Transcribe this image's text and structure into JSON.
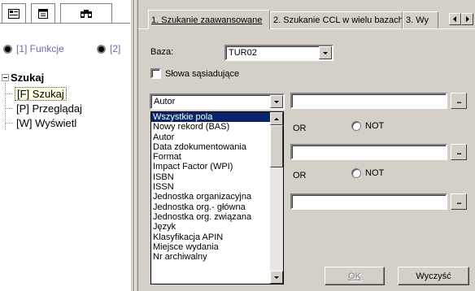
{
  "left_pane": {
    "tabs": [
      {
        "icon": "tree-view-icon"
      },
      {
        "icon": "document-icon"
      },
      {
        "icon": "binoculars-icon"
      }
    ],
    "radio_options": [
      "[1] Funkcje",
      "[2]"
    ],
    "tree": {
      "root": "Szukaj",
      "children": [
        {
          "label": "[F] Szukaj",
          "selected": true
        },
        {
          "label": "[P] Przeglądaj",
          "selected": false
        },
        {
          "label": "[W] Wyświetl",
          "selected": false
        }
      ]
    }
  },
  "right_pane": {
    "tabs": [
      {
        "label": "1. Szukanie zaawansowane",
        "active": true
      },
      {
        "label": "2. Szukanie CCL w wielu bazach",
        "active": false
      },
      {
        "label": "3. Wy",
        "active": false
      }
    ],
    "baza_label": "Baza:",
    "baza_value": "TUR02",
    "neighbours_checkbox": "Słowa sąsiadujące",
    "field_combo_value": "Autor",
    "field_options": [
      "Wszystkie pola",
      "Nowy rekord (BAS)",
      "Autor",
      "Data zdokumentowania",
      "Format",
      "Impact Factor (WPI)",
      "ISBN",
      "ISSN",
      "Jednostka organizacyjna",
      "Jednostka org.- główna",
      "Jednostka org. związana",
      "Język",
      "Klasyfikacja APIN",
      "Miejsce wydania",
      "Nr archiwalny"
    ],
    "selected_option_index": 0,
    "operators_row1": {
      "or": "OR",
      "not": "NOT"
    },
    "operators_row2": {
      "or": "OR",
      "not": "NOT"
    },
    "ellipsis": "...",
    "ok_button": "OK",
    "clear_button": "Wyczyść"
  }
}
